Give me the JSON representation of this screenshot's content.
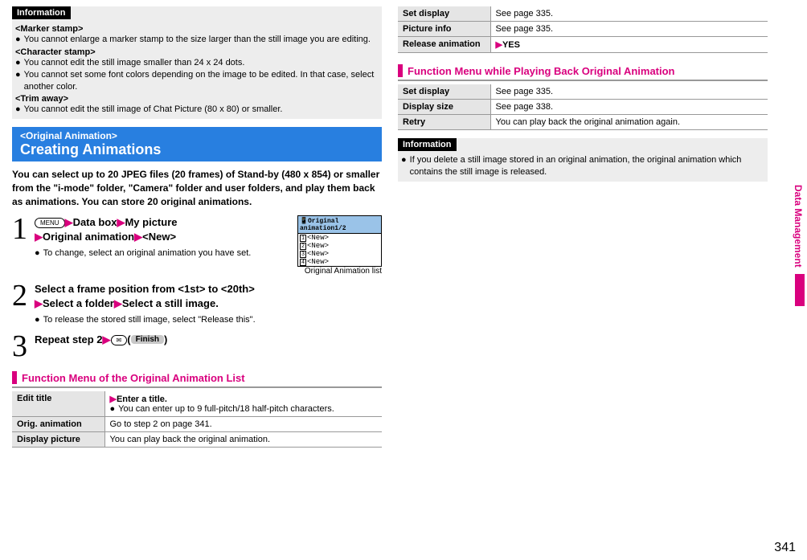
{
  "col1": {
    "info_label": "Information",
    "marker_label": "<Marker stamp>",
    "marker_b1": "You cannot enlarge a marker stamp to the size larger than the still image you are editing.",
    "char_label": "<Character stamp>",
    "char_b1": "You cannot edit the still image smaller than 24 x 24 dots.",
    "char_b2": "You cannot set some font colors depending on the image to be edited. In that case, select another color.",
    "trim_label": "<Trim away>",
    "trim_b1": "You cannot edit the still image of Chat Picture (80 x 80) or smaller.",
    "section_small": "<Original Animation>",
    "section_big": "Creating Animations",
    "intro": "You can select up to 20 JPEG files (20 frames) of Stand-by (480 x 854) or smaller from the \"i-mode\" folder, \"Camera\" folder and user folders, and play them back as animations. You can store 20 original animations.",
    "menu_label": "MENU",
    "step1_text1": "Data box",
    "step1_text2": "My picture",
    "step1_text3": "Original animation",
    "step1_text4": "<New>",
    "step1_note": "To change, select an original animation you have set.",
    "screen_title": "Original animation1/2",
    "screen_items": [
      "<New>",
      "<New>",
      "<New>",
      "<New>"
    ],
    "screen_caption": "Original Animation list",
    "step2_a": "Select a frame position from <1st> to <20th>",
    "step2_b": "Select a folder",
    "step2_c": "Select a still image.",
    "step2_note": "To release the stored still image, select \"Release this\".",
    "step3_text": "Repeat step 2",
    "finish_label": "Finish",
    "func1_title": "Function Menu of the Original Animation List",
    "t1": {
      "edit_title": "Edit title",
      "edit_desc_a": "Enter a title.",
      "edit_desc_b": "You can enter up to 9 full-pitch/18 half-pitch characters.",
      "orig": "Orig. animation",
      "orig_desc": "Go to step 2 on page 341.",
      "disp": "Display picture",
      "disp_desc": "You can play back the original animation."
    }
  },
  "col2": {
    "t2": {
      "setdisp": "Set display",
      "setdisp_desc": "See page 335.",
      "picinfo": "Picture info",
      "picinfo_desc": "See page 335.",
      "relanim": "Release animation",
      "yes": "YES"
    },
    "func2_title": "Function Menu while Playing Back Original Animation",
    "t3": {
      "setdisp": "Set display",
      "setdisp_desc": "See page 335.",
      "dispsize": "Display size",
      "dispsize_desc": "See page 338.",
      "retry": "Retry",
      "retry_desc": "You can play back the original animation again."
    },
    "info_label": "Information",
    "info_b1": "If you delete a still image stored in an original animation, the original animation which contains the still image is released."
  },
  "sidetab": "Data Management",
  "pagenum": "341"
}
